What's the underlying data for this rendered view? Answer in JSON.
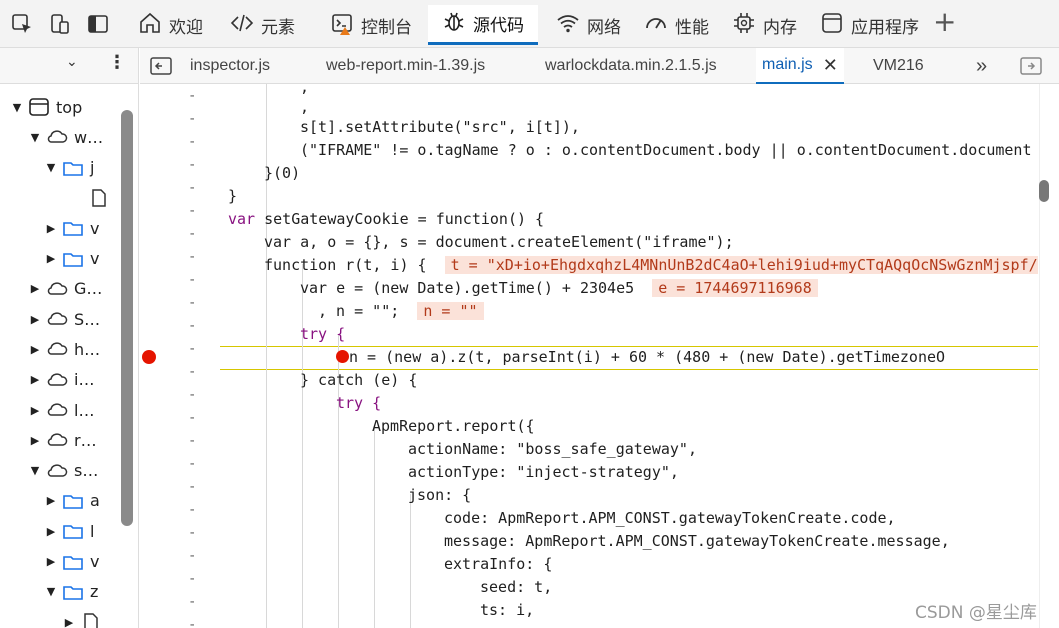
{
  "panel_tabs": [
    {
      "label": "欢迎",
      "icon": "home-icon"
    },
    {
      "label": "元素",
      "icon": "code-tag-icon"
    },
    {
      "label": "控制台",
      "icon": "console-icon"
    },
    {
      "label": "源代码",
      "icon": "bug-icon"
    },
    {
      "label": "网络",
      "icon": "wifi-icon"
    },
    {
      "label": "性能",
      "icon": "gauge-icon"
    },
    {
      "label": "内存",
      "icon": "chip-icon"
    },
    {
      "label": "应用程序",
      "icon": "app-window-icon"
    }
  ],
  "active_panel_tab": "源代码",
  "file_tabs": [
    {
      "label": "inspector.js"
    },
    {
      "label": "web-report.min-1.39.js"
    },
    {
      "label": "warlockdata.min.2.1.5.js"
    },
    {
      "label": "main.js"
    },
    {
      "label": "VM216"
    }
  ],
  "active_file_tab": "main.js",
  "tree": [
    {
      "label": "top",
      "icon": "frame-icon",
      "tri": "▼"
    },
    {
      "label": "w…",
      "icon": "cloud-icon",
      "tri": "▼"
    },
    {
      "label": "j",
      "icon": "folder-icon",
      "tri": "▼"
    },
    {
      "label": "",
      "icon": "file-icon",
      "tri": ""
    },
    {
      "label": "v",
      "icon": "folder-icon",
      "tri": "▶"
    },
    {
      "label": "v",
      "icon": "folder-icon",
      "tri": "▶"
    },
    {
      "label": "G…",
      "icon": "cloud-icon",
      "tri": "▶"
    },
    {
      "label": "S…",
      "icon": "cloud-icon",
      "tri": "▶"
    },
    {
      "label": "h…",
      "icon": "cloud-icon",
      "tri": "▶"
    },
    {
      "label": "i…",
      "icon": "cloud-icon",
      "tri": "▶"
    },
    {
      "label": "l…",
      "icon": "cloud-icon",
      "tri": "▶"
    },
    {
      "label": "r…",
      "icon": "cloud-icon",
      "tri": "▶"
    },
    {
      "label": "s…",
      "icon": "cloud-icon",
      "tri": "▼"
    },
    {
      "label": "a",
      "icon": "folder-icon",
      "tri": "▶"
    },
    {
      "label": "l",
      "icon": "folder-icon",
      "tri": "▶"
    },
    {
      "label": "v",
      "icon": "folder-icon",
      "tri": "▶"
    },
    {
      "label": "z",
      "icon": "folder-icon",
      "tri": "▼"
    },
    {
      "label": "",
      "icon": "file-icon",
      "tri": "▶"
    }
  ],
  "code": {
    "l0": ",",
    "l1": "s[t].setAttribute(\"src\", i[t]),",
    "l2": "(\"IFRAME\" != o.tagName ? o : o.contentDocument.body || o.contentDocument.document",
    "l3": "}(0)",
    "l4": "}",
    "l5_kw": "var",
    "l5": " setGatewayCookie = function() {",
    "l6": "var a, o = {}, s = document.createElement(\"iframe\");",
    "l7_a": "function r(t, i) {",
    "l7_val": "t = \"xD+io+EhgdxqhzL4MNnUnB2dC4aO+lehi9iud+myCTqAQqOcNSwGznMjspf/",
    "l8_a": "var e = (new Date).getTime() + 2304e5",
    "l8_val": "e = 1744697116968",
    "l9_a": ", n = \"\";",
    "l9_val": "n = \"\"",
    "l10": "try {",
    "l11": "n = (new a).z(t, parseInt(i) + 60 * (480 + (new Date).getTimezoneO",
    "l12": "} catch (e) {",
    "l13": "try {",
    "l14": "ApmReport.report({",
    "l15": "actionName: \"boss_safe_gateway\",",
    "l16": "actionType: \"inject-strategy\",",
    "l17": "json: {",
    "l18": "code: ApmReport.APM_CONST.gatewayTokenCreate.code,",
    "l19": "message: ApmReport.APM_CONST.gatewayTokenCreate.message,",
    "l20": "extraInfo: {",
    "l21": "seed: t,",
    "l22": "ts: i,"
  },
  "watermark": "CSDN @星尘库"
}
